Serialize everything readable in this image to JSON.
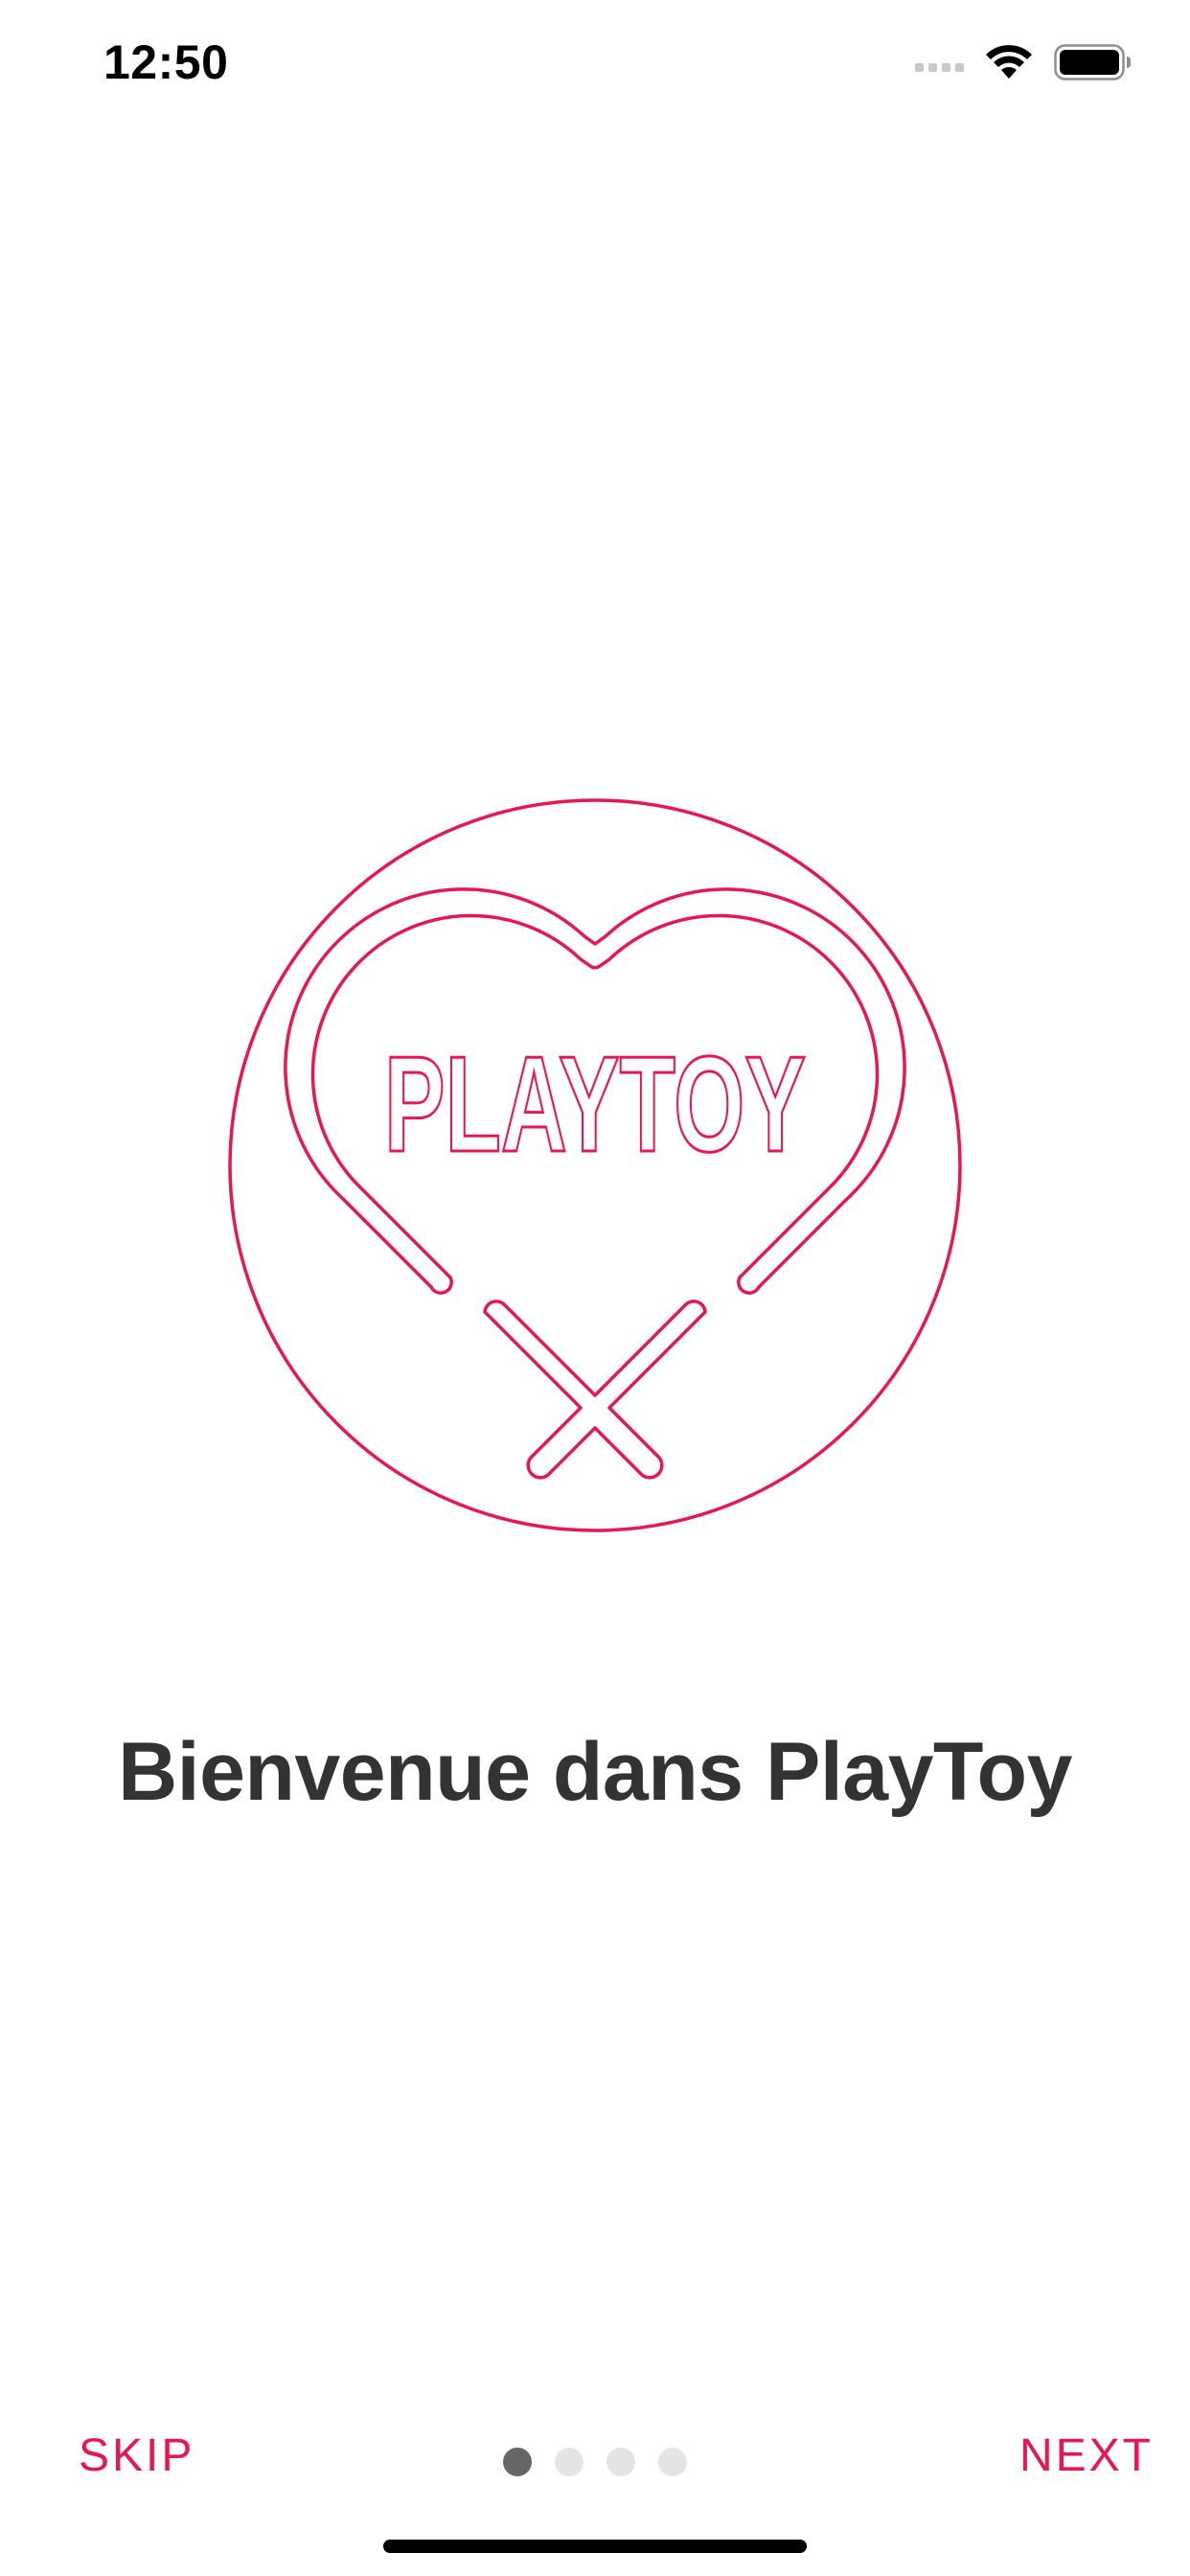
{
  "status_bar": {
    "time": "12:50",
    "icons": [
      "signal-dots-icon",
      "wifi-icon",
      "battery-icon"
    ]
  },
  "logo": {
    "text": "PLAYTOY",
    "icon": "heart-logo-icon",
    "color": "#e8174f"
  },
  "onboarding": {
    "title": "Bienvenue dans PlayToy",
    "page_count": 4,
    "current_page": 1
  },
  "controls": {
    "skip_label": "SKIP",
    "next_label": "NEXT"
  },
  "colors": {
    "accent": "#e8174f",
    "title": "#333333",
    "dot_active": "#666666",
    "dot_inactive": "#e4e4e4"
  }
}
